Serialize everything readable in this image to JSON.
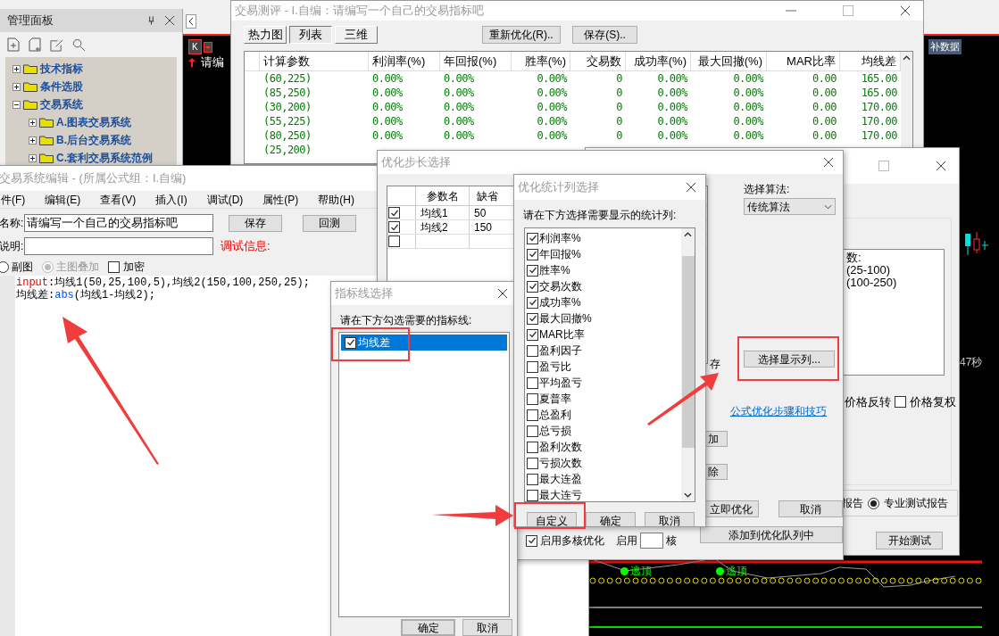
{
  "panel": {
    "title": "管理面板",
    "tree": [
      {
        "label": "技术指标",
        "expanded": false
      },
      {
        "label": "条件选股",
        "expanded": false
      },
      {
        "label": "交易系统",
        "expanded": true,
        "children": [
          {
            "label": "A.图表交易系统",
            "expanded": false
          },
          {
            "label": "B.后台交易系统",
            "expanded": false
          },
          {
            "label": "C.套利交易系统范例",
            "expanded": false
          }
        ]
      }
    ]
  },
  "chart": {
    "badge": "K",
    "label": "请编",
    "data_button": "补数据",
    "timer": "47秒",
    "signals": [
      {
        "label": "逃顶"
      },
      {
        "label": "逃顶"
      }
    ]
  },
  "evaluation": {
    "title": "交易测评 - I.自编：请编写一个自己的交易指标吧",
    "tabs": [
      {
        "label": "热力图",
        "selected": false
      },
      {
        "label": "列表",
        "selected": true
      },
      {
        "label": "三维",
        "selected": false
      }
    ],
    "buttons": [
      "重新优化(R)..",
      "保存(S).."
    ],
    "columns": [
      "计算参数",
      "利润率(%)",
      "年回报(%)",
      "胜率(%)",
      "交易数",
      "成功率(%)",
      "最大回撤(%)",
      "MAR比率",
      "均线差"
    ],
    "rows": [
      [
        "(60,225)",
        "0.00%",
        "0.00%",
        "0.00%",
        "0",
        "0.00%",
        "0.00%",
        "0.00",
        "165.00"
      ],
      [
        "(85,250)",
        "0.00%",
        "0.00%",
        "0.00%",
        "0",
        "0.00%",
        "0.00%",
        "0.00",
        "165.00"
      ],
      [
        "(30,200)",
        "0.00%",
        "0.00%",
        "0.00%",
        "0",
        "0.00%",
        "0.00%",
        "0.00",
        "170.00"
      ],
      [
        "(55,225)",
        "0.00%",
        "0.00%",
        "0.00%",
        "0",
        "0.00%",
        "0.00%",
        "0.00",
        "170.00"
      ],
      [
        "(80,250)",
        "0.00%",
        "0.00%",
        "0.00%",
        "0",
        "0.00%",
        "0.00%",
        "0.00",
        "170.00"
      ],
      [
        "(25,200)"
      ]
    ]
  },
  "test_window": {
    "list_lines": [
      "数:",
      "(25-100)",
      "(100-250)"
    ],
    "reverse_label": "价格反转",
    "adjust": {
      "label": "价格复权",
      "checked": false
    },
    "report_label": "报告",
    "pro_report": {
      "label": "专业测试报告",
      "selected": true
    },
    "start_button": "开始测试"
  },
  "editor": {
    "title": "交易系统编辑 - (所属公式组：I.自编)",
    "menu": [
      "件(F)",
      "编辑(E)",
      "查看(V)",
      "插入(I)",
      "调试(D)",
      "属性(P)",
      "帮助(H)"
    ],
    "name_label": "名称:",
    "name_value": "请编写一个自己的交易指标吧",
    "desc_label": "说明:",
    "buttons": [
      "保存",
      "回测"
    ],
    "debug_label": "调试信息:",
    "layout_options": [
      {
        "label": "副图",
        "selected": false,
        "disabled": false
      },
      {
        "label": "主图叠加",
        "selected": true,
        "disabled": true
      }
    ],
    "encrypt": {
      "label": "加密",
      "checked": false
    },
    "code": [
      [
        {
          "kind": "keyword",
          "text": "input"
        },
        {
          "kind": "plain",
          "text": ":均线1(50,25,100,5),均线2(150,100,250,25);"
        }
      ],
      [
        {
          "kind": "plain",
          "text": "均线差:"
        },
        {
          "kind": "function",
          "text": "abs"
        },
        {
          "kind": "plain",
          "text": "(均线1-均线2);"
        }
      ]
    ]
  },
  "step_window": {
    "title": "优化步长选择",
    "columns": [
      "参数名",
      "缺省"
    ],
    "params": [
      {
        "name": "均线1",
        "default": "50",
        "checked": true
      },
      {
        "name": "均线2",
        "default": "150",
        "checked": true
      },
      {
        "checked": false
      }
    ],
    "algorithm_label": "选择算法:",
    "algorithm": "传统算法",
    "columns_button": "选择显示列...",
    "partial_label": "存",
    "tips_link": "公式优化步骤和技巧",
    "side_buttons": [
      "加",
      "除"
    ],
    "run_button": "立即优化",
    "cancel_button": "取消",
    "queue_button": "添加到优化队列中",
    "multicore": {
      "label": "启用多核优化",
      "checked": true
    },
    "cores_label": "启用",
    "cores_unit": "核"
  },
  "stats_window": {
    "title": "优化统计列选择",
    "prompt": "请在下方选择需要显示的统计列:",
    "items": [
      {
        "label": "利润率%",
        "checked": true
      },
      {
        "label": "年回报%",
        "checked": true
      },
      {
        "label": "胜率%",
        "checked": true
      },
      {
        "label": "交易次数",
        "checked": true
      },
      {
        "label": "成功率%",
        "checked": true
      },
      {
        "label": "最大回撤%",
        "checked": true
      },
      {
        "label": "MAR比率",
        "checked": true
      },
      {
        "label": "盈利因子",
        "checked": false
      },
      {
        "label": "盈亏比",
        "checked": false
      },
      {
        "label": "平均盈亏",
        "checked": false
      },
      {
        "label": "夏普率",
        "checked": false
      },
      {
        "label": "总盈利",
        "checked": false
      },
      {
        "label": "总亏损",
        "checked": false
      },
      {
        "label": "盈利次数",
        "checked": false
      },
      {
        "label": "亏损次数",
        "checked": false
      },
      {
        "label": "最大连盈",
        "checked": false
      },
      {
        "label": "最大连亏",
        "checked": false
      }
    ],
    "buttons": [
      "自定义",
      "确定",
      "取消"
    ]
  },
  "line_window": {
    "title": "指标线选择",
    "prompt": "请在下方勾选需要的指标线:",
    "items": [
      {
        "label": "均线差",
        "checked": true,
        "selected": true
      }
    ],
    "buttons": [
      "确定",
      "取消"
    ]
  }
}
